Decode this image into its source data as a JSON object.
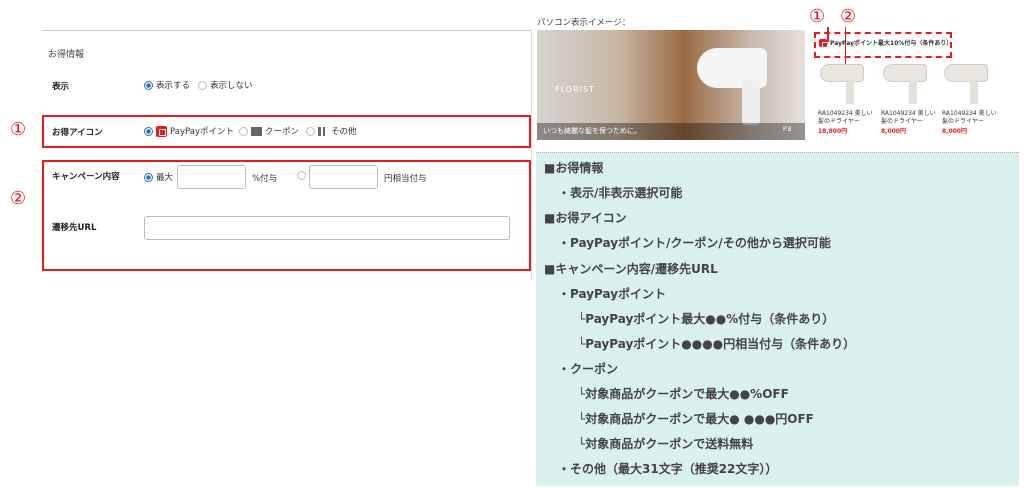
{
  "form": {
    "section_title": "お得情報",
    "display": {
      "label": "表示",
      "options": [
        "表示する",
        "表示しない"
      ]
    },
    "icon": {
      "label": "お得アイコン",
      "options": [
        "PayPayポイント",
        "クーポン",
        "その他"
      ]
    },
    "campaign": {
      "label": "キャンペーン内容",
      "max_label": "最大",
      "percent_label": "%付与",
      "yen_label": "円相当付与"
    },
    "url": {
      "label": "遷移先URL"
    }
  },
  "markers": {
    "one": "①",
    "two": "②"
  },
  "preview": {
    "label": "パソコン表示イメージ：",
    "brand": "FLORIST",
    "hero_caption": "いつも綺麗な髪を保つために。",
    "hero_page": "P.8",
    "badge": "PayPayポイント最大10%付与（条件あり）",
    "products": [
      {
        "name": "RA1049234 美しい髪のドライヤー",
        "price": "18,800円"
      },
      {
        "name": "RA1049234 美しい髪のドライヤー",
        "price": "8,000円"
      },
      {
        "name": "RA1049234 美しい髪のドライヤー",
        "price": "8,000円"
      }
    ]
  },
  "info_lines": [
    "■お得情報",
    "・表示/非表示選択可能",
    "■お得アイコン",
    "・PayPayポイント/クーポン/その他から選択可能",
    "■キャンペーン内容/遷移先URL",
    "・PayPayポイント",
    "└PayPayポイント最大●●%付与（条件あり）",
    "└PayPayポイント●●●●円相当付与（条件あり）",
    "・クーポン",
    "└対象商品がクーポンで最大●●%OFF",
    "└対象商品がクーポンで最大● ●●●円OFF",
    "└対象商品がクーポンで送料無料",
    "・その他（最大31文字（推奨22文字））"
  ],
  "colors": {
    "accent_red": "#e8191f",
    "radio_blue": "#2a6ebb",
    "info_bg": "#d9f0ef"
  }
}
